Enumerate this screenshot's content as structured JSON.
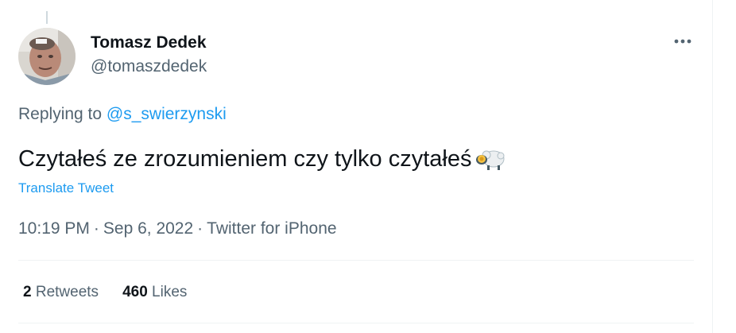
{
  "tweet": {
    "author": {
      "display_name": "Tomasz Dedek",
      "handle": "@tomaszdedek"
    },
    "replying_prefix": "Replying to",
    "replying_to": "@s_swierzynski",
    "text": "Czytałeś ze zrozumieniem czy tylko czytałeś",
    "emoji": "sheep-emoji",
    "translate_label": "Translate Tweet",
    "time": "10:19 PM",
    "date": "Sep 6, 2022",
    "source": "Twitter for iPhone",
    "separator": "·",
    "stats": {
      "retweets_count": "2",
      "retweets_label": "Retweets",
      "likes_count": "460",
      "likes_label": "Likes"
    }
  },
  "icons": {
    "more": "more-horizontal-icon",
    "avatar": "avatar"
  },
  "colors": {
    "text_primary": "#0f1419",
    "text_secondary": "#536471",
    "link": "#1d9bf0",
    "divider": "#eff3f4"
  }
}
